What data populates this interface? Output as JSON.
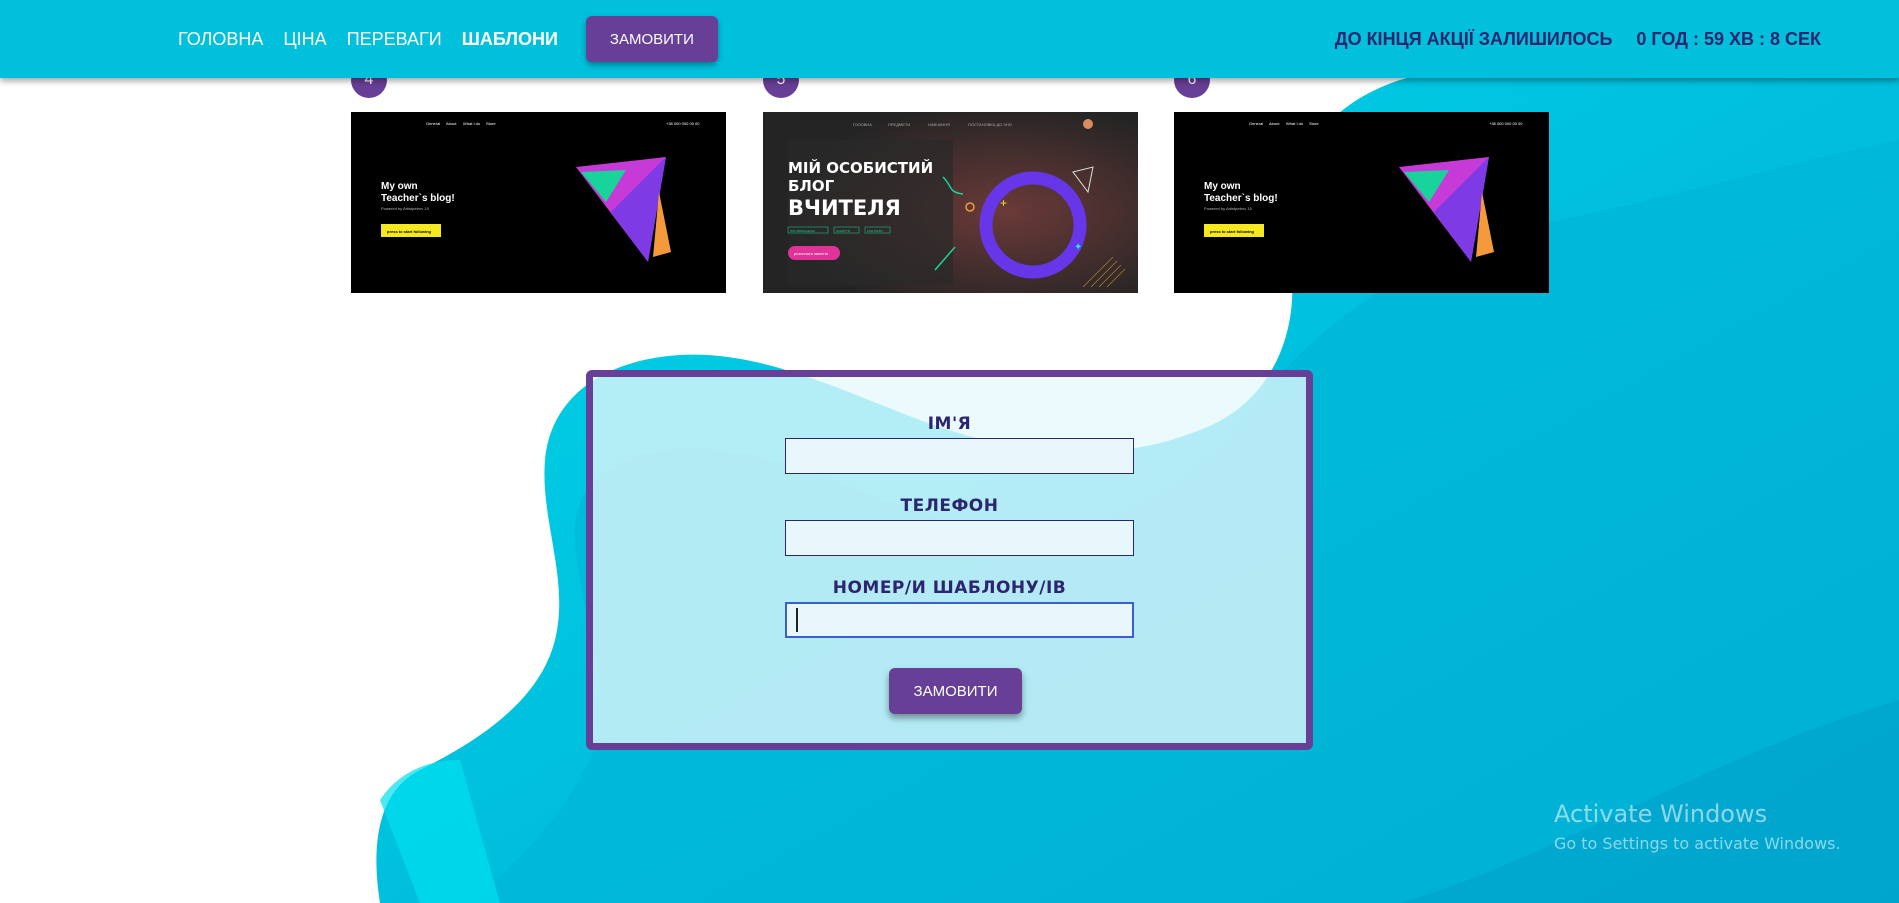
{
  "nav": {
    "links": [
      "ГОЛОВНА",
      "ЦІНА",
      "ПЕРЕВАГИ",
      "ШАБЛОНИ"
    ],
    "active": "ШАБЛОНИ",
    "order_label": "ЗАМОВИТИ"
  },
  "countdown": {
    "label": "ДО КІНЦЯ АКЦІЇ ЗАЛИШИЛОСЬ",
    "value": "0 ГОД : 59 ХВ : 8 СЕК"
  },
  "templates": [
    {
      "number": "4",
      "nav_items": [
        "General",
        "About",
        "What I do",
        "Store"
      ],
      "phone": "+38 000 000 00 00",
      "heading": [
        "My own",
        "Teacher`s blog!"
      ],
      "sub": "Powered by Artistpetrov 15",
      "cta": "press to start following"
    },
    {
      "number": "5",
      "nav_items": [
        "ГОЛОВНА",
        "ПРЕДМЕТИ",
        "НАВЧАННЯ",
        "ПОСТАНОВКА ДО ЗНО"
      ],
      "heading": [
        "МІЙ ОСОБИСТИЙ",
        "БЛОГ",
        "ВЧИТЕЛЯ"
      ],
      "tags": [
        "ПРО ВИКЛАДАЧА",
        "ЗАНЯТТЯ",
        "КОНТАКТИ"
      ],
      "cta": "розпочати заняття"
    },
    {
      "number": "6",
      "nav_items": [
        "General",
        "About",
        "What I do",
        "Store"
      ],
      "phone": "+38 000 000 00 00",
      "heading": [
        "My own",
        "Teacher`s blog!"
      ],
      "sub": "Powered by Artistpetrov 15",
      "cta": "press to start following"
    }
  ],
  "form": {
    "name_label": "ІМ'Я",
    "name_value": "",
    "phone_label": "ТЕЛЕФОН",
    "phone_value": "",
    "template_label": "НОМЕР/И ШАБЛОНУ/ІВ",
    "template_value": "",
    "submit_label": "ЗАМОВИТИ"
  },
  "watermark": {
    "title": "Activate Windows",
    "subtitle": "Go to Settings to activate Windows."
  },
  "colors": {
    "nav_bg": "#00c0dc",
    "accent_purple": "#673f96",
    "text_navy": "#2d2570",
    "wave_cyan": "#00c8e0"
  }
}
